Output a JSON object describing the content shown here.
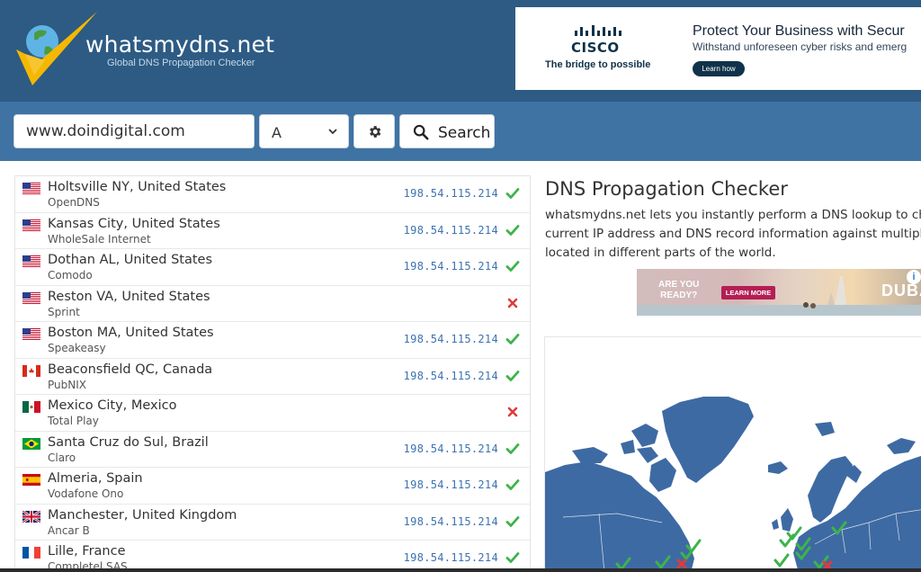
{
  "site": {
    "title": "whatsmydns.net",
    "subtitle": "Global DNS Propagation Checker"
  },
  "top_ad": {
    "brand": "CISCO",
    "tagline": "The bridge to possible",
    "headline": "Protect Your Business with Secur",
    "subline": "Withstand unforeseen cyber risks and emerg",
    "button": "Learn how"
  },
  "search": {
    "domain_value": "www.doindigital.com",
    "record_type": "A",
    "button_label": "Search"
  },
  "results": [
    {
      "location": "Holtsville NY, United States",
      "provider": "OpenDNS",
      "ip": "198.54.115.214",
      "ok": true,
      "flag": "us"
    },
    {
      "location": "Kansas City, United States",
      "provider": "WholeSale Internet",
      "ip": "198.54.115.214",
      "ok": true,
      "flag": "us"
    },
    {
      "location": "Dothan AL, United States",
      "provider": "Comodo",
      "ip": "198.54.115.214",
      "ok": true,
      "flag": "us"
    },
    {
      "location": "Reston VA, United States",
      "provider": "Sprint",
      "ip": "",
      "ok": false,
      "flag": "us"
    },
    {
      "location": "Boston MA, United States",
      "provider": "Speakeasy",
      "ip": "198.54.115.214",
      "ok": true,
      "flag": "us"
    },
    {
      "location": "Beaconsfield QC, Canada",
      "provider": "PubNIX",
      "ip": "198.54.115.214",
      "ok": true,
      "flag": "ca"
    },
    {
      "location": "Mexico City, Mexico",
      "provider": "Total Play",
      "ip": "",
      "ok": false,
      "flag": "mx"
    },
    {
      "location": "Santa Cruz do Sul, Brazil",
      "provider": "Claro",
      "ip": "198.54.115.214",
      "ok": true,
      "flag": "br"
    },
    {
      "location": "Almeria, Spain",
      "provider": "Vodafone Ono",
      "ip": "198.54.115.214",
      "ok": true,
      "flag": "es"
    },
    {
      "location": "Manchester, United Kingdom",
      "provider": "Ancar B",
      "ip": "198.54.115.214",
      "ok": true,
      "flag": "gb"
    },
    {
      "location": "Lille, France",
      "provider": "Completel SAS",
      "ip": "198.54.115.214",
      "ok": true,
      "flag": "fr"
    }
  ],
  "info": {
    "title": "DNS Propagation Checker",
    "desc_lines": [
      "whatsmydns.net lets you instantly perform a DNS lookup to chec",
      "current IP address and DNS record information against multiple r",
      "located in different parts of the world."
    ]
  },
  "side_ad": {
    "text_line1": "ARE YOU",
    "text_line2": "READY?",
    "button": "LEARN MORE",
    "city": "DUBA"
  },
  "colors": {
    "header": "#2d5b84",
    "searchbar": "#3f73a4",
    "ok": "#3cb44b",
    "fail": "#e03b3b",
    "ip": "#3c72b0",
    "land": "#3e6aa3"
  }
}
